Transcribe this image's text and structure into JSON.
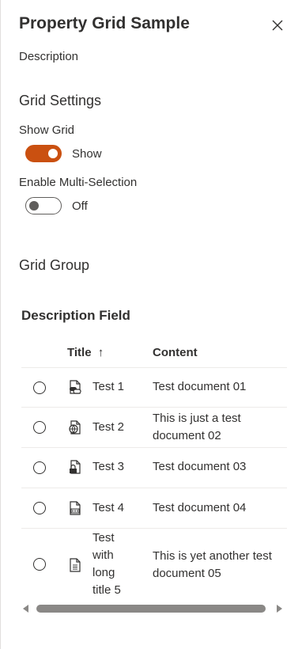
{
  "panel": {
    "title": "Property Grid Sample",
    "description": "Description"
  },
  "grid_settings": {
    "title": "Grid Settings",
    "show_grid": {
      "label": "Show Grid",
      "state_text": "Show",
      "on": true
    },
    "multi_selection": {
      "label": "Enable Multi-Selection",
      "state_text": "Off",
      "on": false
    }
  },
  "grid_group": {
    "title": "Grid Group"
  },
  "description_field": {
    "label": "Description Field",
    "columns": {
      "title": "Title",
      "sort_indicator": "↑",
      "content": "Content"
    },
    "rows": [
      {
        "title": "Test 1",
        "content": "Test document 01",
        "icon": "link-document-icon"
      },
      {
        "title": "Test 2",
        "content": "This is just a test document 02",
        "icon": "globe-document-icon"
      },
      {
        "title": "Test 3",
        "content": "Test document 03",
        "icon": "lock-document-icon"
      },
      {
        "title": "Test 4",
        "content": "Test document 04",
        "icon": "code-document-icon"
      },
      {
        "title": "Test with long title 5",
        "content": "This is yet another test document 05",
        "icon": "text-document-icon"
      }
    ]
  },
  "colors": {
    "accent": "#ca5010",
    "text": "#323130",
    "divider": "#edebe9"
  }
}
